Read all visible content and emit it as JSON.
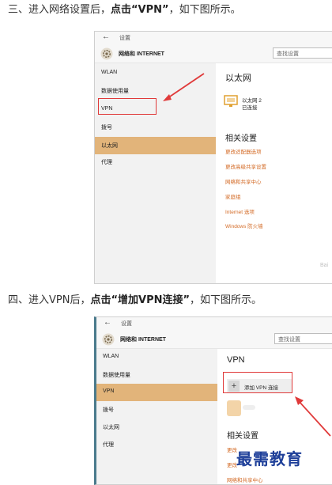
{
  "steps": [
    {
      "prefix": "三、进入网络设置后，",
      "bold": "点击“VPN”",
      "suffix": "，如下图所示。"
    },
    {
      "prefix": "四、进入VPN后，",
      "bold": "点击“增加VPN连接”",
      "suffix": "，如下图所示。"
    }
  ],
  "settings_window": {
    "back_glyph": "←",
    "title": "设置",
    "header": "网络和 INTERNET",
    "search_placeholder": "查找设置",
    "nav_items": [
      "WLAN",
      "数据使用量",
      "VPN",
      "拨号",
      "以太网",
      "代理"
    ]
  },
  "screenshot1": {
    "active_nav": "以太网",
    "heading": "以太网",
    "adapter_name": "以太网 2",
    "adapter_status": "已连接",
    "related_heading": "相关设置",
    "related_links": [
      "更改适配器选项",
      "更改高级共享设置",
      "网络和共享中心",
      "家庭组",
      "Internet 选项",
      "Windows 防火墙"
    ],
    "corner_mark": "Bai"
  },
  "screenshot2": {
    "active_nav": "VPN",
    "heading": "VPN",
    "add_plus": "+",
    "add_label": "添加 VPN 连接",
    "related_heading": "相关设置",
    "related_links": [
      "更改",
      "更改",
      "网络和共享中心"
    ]
  },
  "watermark": "最需教育",
  "colors": {
    "active_nav_bg": "#e2b47a",
    "link": "#d36a25",
    "highlight": "#e03a3a",
    "watermark": "#1e3f99"
  }
}
